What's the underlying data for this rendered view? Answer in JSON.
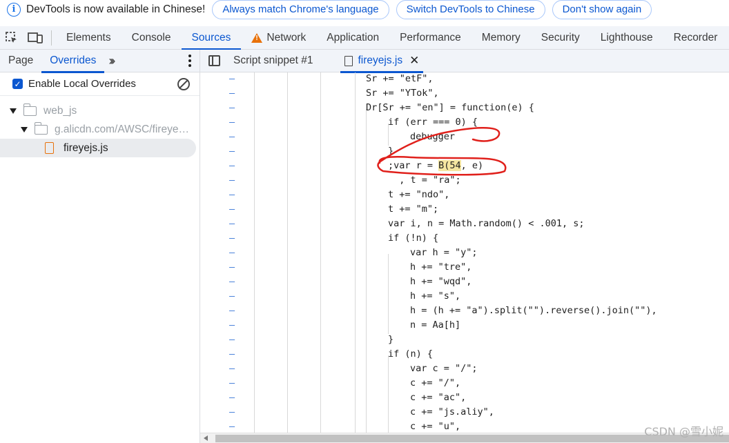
{
  "infobar": {
    "message": "DevTools is now available in Chinese!",
    "buttons": [
      "Always match Chrome's language",
      "Switch DevTools to Chinese",
      "Don't show again"
    ]
  },
  "main_tabs": [
    {
      "label": "Elements"
    },
    {
      "label": "Console"
    },
    {
      "label": "Sources",
      "active": true
    },
    {
      "label": "Network",
      "warning": true
    },
    {
      "label": "Application"
    },
    {
      "label": "Performance"
    },
    {
      "label": "Memory"
    },
    {
      "label": "Security"
    },
    {
      "label": "Lighthouse"
    },
    {
      "label": "Recorder"
    }
  ],
  "left_panel": {
    "tabs": [
      "Page",
      "Overrides"
    ],
    "active_tab": "Overrides",
    "enable_overrides_label": "Enable Local Overrides",
    "tree": {
      "root_folder": "web_js",
      "sub_folder": "g.alicdn.com/AWSC/fireye…",
      "file": "fireyejs.js"
    }
  },
  "editor": {
    "tabs": [
      {
        "label": "Script snippet #1"
      },
      {
        "label": "fireyejs.js",
        "active": true
      }
    ],
    "code_lines": [
      {
        "indent": 0,
        "text": "Sr += \"etF\","
      },
      {
        "indent": 0,
        "text": "Sr += \"YTok\","
      },
      {
        "indent": 0,
        "text": "Dr[Sr += \"en\"] = function(e) {"
      },
      {
        "indent": 1,
        "text": "if (err === 0) {"
      },
      {
        "indent": 2,
        "text": "debugger"
      },
      {
        "indent": 1,
        "text": "}"
      },
      {
        "indent": 1,
        "text": ";var r = ",
        "hl": "B(54",
        "after": ", e)"
      },
      {
        "indent": 1,
        "text": "  , t = \"ra\";"
      },
      {
        "indent": 1,
        "text": "t += \"ndo\","
      },
      {
        "indent": 1,
        "text": "t += \"m\";"
      },
      {
        "indent": 1,
        "text": "var i, n = Math.random() < .001, s;"
      },
      {
        "indent": 1,
        "text": "if (!n) {"
      },
      {
        "indent": 2,
        "text": "var h = \"y\";"
      },
      {
        "indent": 2,
        "text": "h += \"tre\","
      },
      {
        "indent": 2,
        "text": "h += \"wqd\","
      },
      {
        "indent": 2,
        "text": "h += \"s\","
      },
      {
        "indent": 2,
        "text": "h = (h += \"a\").split(\"\").reverse().join(\"\"),"
      },
      {
        "indent": 2,
        "text": "n = Aa[h]"
      },
      {
        "indent": 1,
        "text": "}"
      },
      {
        "indent": 1,
        "text": "if (n) {"
      },
      {
        "indent": 2,
        "text": "var c = \"/\";"
      },
      {
        "indent": 2,
        "text": "c += \"/\","
      },
      {
        "indent": 2,
        "text": "c += \"ac\","
      },
      {
        "indent": 2,
        "text": "c += \"js.aliy\","
      },
      {
        "indent": 2,
        "text": "c += \"u\","
      }
    ]
  },
  "watermark": "CSDN @雪小妮",
  "colors": {
    "accent": "#0b57d0",
    "annotation": "#e0201b",
    "warning": "#e8710a"
  }
}
